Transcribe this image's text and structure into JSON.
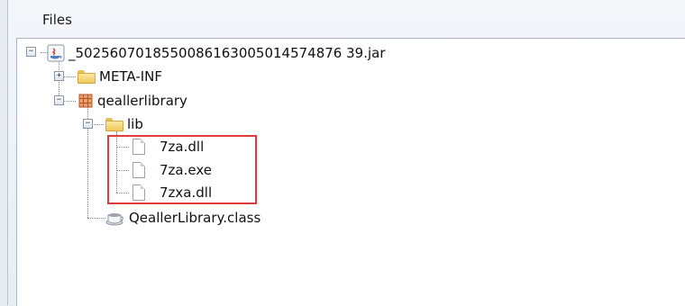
{
  "panel": {
    "title": "Files"
  },
  "tree": {
    "jar": "_5025607018550086163005014574876 39.jar",
    "meta_inf": "META-INF",
    "package": "qeallerlibrary",
    "lib": "lib",
    "files": [
      "7za.dll",
      "7za.exe",
      "7zxa.dll"
    ],
    "class_file": "QeallerLibrary.class"
  },
  "colors": {
    "highlight": "#e03b3b",
    "folder": "#f0c85a",
    "package": "#b8522e"
  },
  "icons": {
    "jar": "java-jar-icon",
    "folder": "folder-icon",
    "package": "package-icon",
    "file": "file-icon",
    "class": "class-file-icon"
  }
}
